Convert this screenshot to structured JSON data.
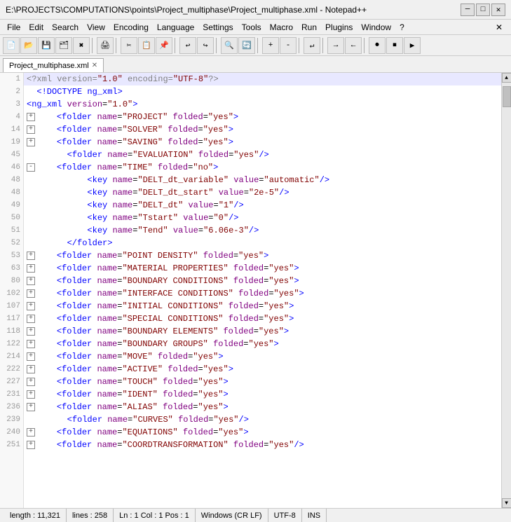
{
  "titlebar": {
    "text": "E:\\PROJECTS\\COMPUTATIONS\\points\\Project_multiphase\\Project_multiphase.xml - Notepad++",
    "minimize": "─",
    "maximize": "□",
    "close": "✕"
  },
  "menubar": {
    "items": [
      "File",
      "Edit",
      "Search",
      "View",
      "Encoding",
      "Language",
      "Settings",
      "Tools",
      "Macro",
      "Run",
      "Plugins",
      "Window",
      "?"
    ],
    "close": "✕"
  },
  "tab": {
    "label": "Project_multiphase.xml",
    "close": "✕"
  },
  "statusbar": {
    "length": "length : 11,321",
    "lines": "lines : 258",
    "position": "Ln : 1   Col : 1   Pos : 1",
    "lineending": "Windows (CR LF)",
    "encoding": "UTF-8",
    "mode": "INS"
  },
  "lines": [
    {
      "num": "1",
      "indent": 0,
      "fold": false,
      "content": "xml_decl",
      "text": "<?xml version=\"1.0\" encoding=\"UTF-8\"?>"
    },
    {
      "num": "2",
      "indent": 0,
      "fold": false,
      "content": "doctype",
      "text": "<!DOCTYPE ng_xml>"
    },
    {
      "num": "3",
      "indent": 0,
      "fold": false,
      "content": "ng_open",
      "text": "<ng_xml version=\"1.0\">"
    },
    {
      "num": "4",
      "indent": 1,
      "fold": true,
      "content": "folder_project",
      "text": "<folder name=\"PROJECT\" folded=\"yes\">"
    },
    {
      "num": "14",
      "indent": 1,
      "fold": true,
      "content": "folder_solver",
      "text": "<folder name=\"SOLVER\" folded=\"yes\">"
    },
    {
      "num": "19",
      "indent": 1,
      "fold": true,
      "content": "folder_saving",
      "text": "<folder name=\"SAVING\" folded=\"yes\">"
    },
    {
      "num": "45",
      "indent": 1,
      "fold": false,
      "content": "folder_evaluation",
      "text": "<folder name=\"EVALUATION\" folded=\"yes\"/>"
    },
    {
      "num": "46",
      "indent": 1,
      "fold": true,
      "content": "folder_time_open",
      "text": "<folder name=\"TIME\" folded=\"no\">"
    },
    {
      "num": "48",
      "indent": 2,
      "fold": false,
      "content": "key_delt_variable",
      "text": "<key name=\"DELT_dt_variable\" value=\"automatic\"/>"
    },
    {
      "num": "48",
      "indent": 2,
      "fold": false,
      "content": "key_delt_start",
      "text": "<key name=\"DELT_dt_start\" value=\"2e-5\"/>"
    },
    {
      "num": "49",
      "indent": 2,
      "fold": false,
      "content": "key_delt_dt",
      "text": "<key name=\"DELT_dt\" value=\"1\"/>"
    },
    {
      "num": "50",
      "indent": 2,
      "fold": false,
      "content": "key_tstart",
      "text": "<key name=\"Tstart\" value=\"0\"/>"
    },
    {
      "num": "51",
      "indent": 2,
      "fold": false,
      "content": "key_tend",
      "text": "<key name=\"Tend\" value=\"6.06e-3\"/>"
    },
    {
      "num": "52",
      "indent": 1,
      "fold": false,
      "content": "folder_close",
      "text": "</folder>"
    },
    {
      "num": "53",
      "indent": 1,
      "fold": true,
      "content": "folder_pointdensity",
      "text": "<folder name=\"POINT DENSITY\" folded=\"yes\">"
    },
    {
      "num": "63",
      "indent": 1,
      "fold": true,
      "content": "folder_material",
      "text": "<folder name=\"MATERIAL PROPERTIES\" folded=\"yes\">"
    },
    {
      "num": "80",
      "indent": 1,
      "fold": true,
      "content": "folder_boundary",
      "text": "<folder name=\"BOUNDARY CONDITIONS\" folded=\"yes\">"
    },
    {
      "num": "102",
      "indent": 1,
      "fold": true,
      "content": "folder_interface",
      "text": "<folder name=\"INTERFACE CONDITIONS\" folded=\"yes\">"
    },
    {
      "num": "107",
      "indent": 1,
      "fold": true,
      "content": "folder_initial",
      "text": "<folder name=\"INITIAL CONDITIONS\" folded=\"yes\">"
    },
    {
      "num": "117",
      "indent": 1,
      "fold": true,
      "content": "folder_special",
      "text": "<folder name=\"SPECIAL CONDITIONS\" folded=\"yes\">"
    },
    {
      "num": "118",
      "indent": 1,
      "fold": true,
      "content": "folder_boundary_elem",
      "text": "<folder name=\"BOUNDARY ELEMENTS\" folded=\"yes\">"
    },
    {
      "num": "122",
      "indent": 1,
      "fold": true,
      "content": "folder_boundary_grp",
      "text": "<folder name=\"BOUNDARY GROUPS\" folded=\"yes\">"
    },
    {
      "num": "214",
      "indent": 1,
      "fold": true,
      "content": "folder_move",
      "text": "<folder name=\"MOVE\" folded=\"yes\">"
    },
    {
      "num": "222",
      "indent": 1,
      "fold": true,
      "content": "folder_active",
      "text": "<folder name=\"ACTIVE\" folded=\"yes\">"
    },
    {
      "num": "227",
      "indent": 1,
      "fold": true,
      "content": "folder_touch",
      "text": "<folder name=\"TOUCH\" folded=\"yes\">"
    },
    {
      "num": "231",
      "indent": 1,
      "fold": true,
      "content": "folder_ident",
      "text": "<folder name=\"IDENT\" folded=\"yes\">"
    },
    {
      "num": "236",
      "indent": 1,
      "fold": true,
      "content": "folder_alias",
      "text": "<folder name=\"ALIAS\" folded=\"yes\">"
    },
    {
      "num": "239",
      "indent": 1,
      "fold": false,
      "content": "folder_curves",
      "text": "<folder name=\"CURVES\" folded=\"yes\"/>"
    },
    {
      "num": "240",
      "indent": 1,
      "fold": true,
      "content": "folder_equations",
      "text": "<folder name=\"EQUATIONS\" folded=\"yes\">"
    },
    {
      "num": "251",
      "indent": 1,
      "fold": true,
      "content": "folder_coordtrans",
      "text": "<folder name=\"COORDTRANSFORMATION\" folded=\"yes\"/>"
    }
  ],
  "toolbar_icons": [
    "new",
    "open",
    "save",
    "save-all",
    "close",
    "print",
    "separator",
    "cut",
    "copy",
    "paste",
    "undo",
    "redo",
    "separator",
    "find",
    "replace",
    "separator",
    "indent",
    "outdent",
    "separator",
    "wrap",
    "separator",
    "zoom-in",
    "zoom-out",
    "separator",
    "macro-record",
    "macro-stop",
    "macro-play",
    "separator",
    "sync"
  ]
}
